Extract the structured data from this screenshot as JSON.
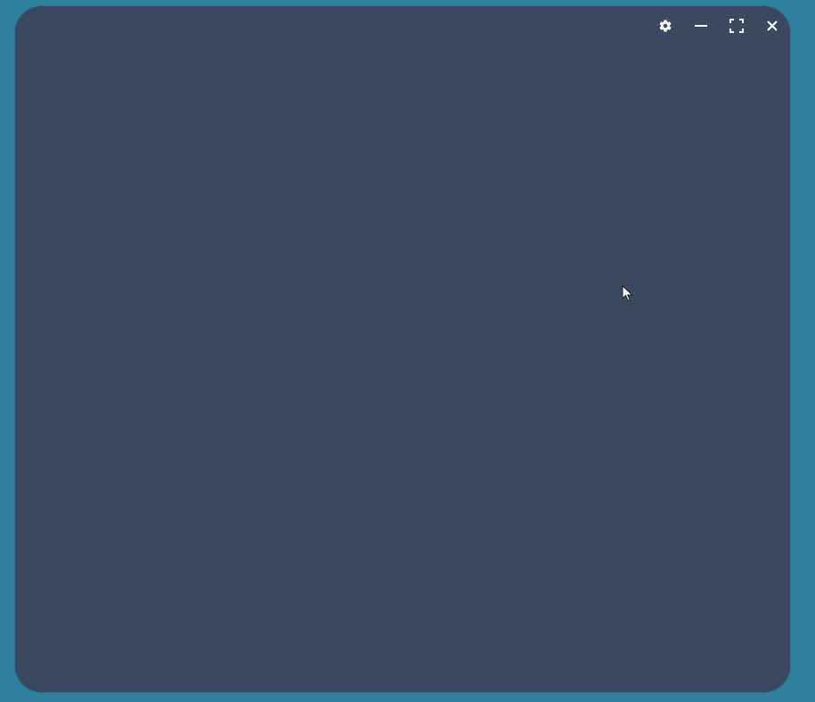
{
  "window": {
    "background_color": "#3b4862",
    "desktop_color": "#2e7f9c",
    "controls": [
      {
        "name": "settings",
        "icon": "gear-icon"
      },
      {
        "name": "minimize",
        "icon": "minimize-icon"
      },
      {
        "name": "maximize",
        "icon": "maximize-icon"
      },
      {
        "name": "close",
        "icon": "close-icon"
      }
    ]
  },
  "pointer": {
    "icon": "mouse-cursor-icon"
  }
}
